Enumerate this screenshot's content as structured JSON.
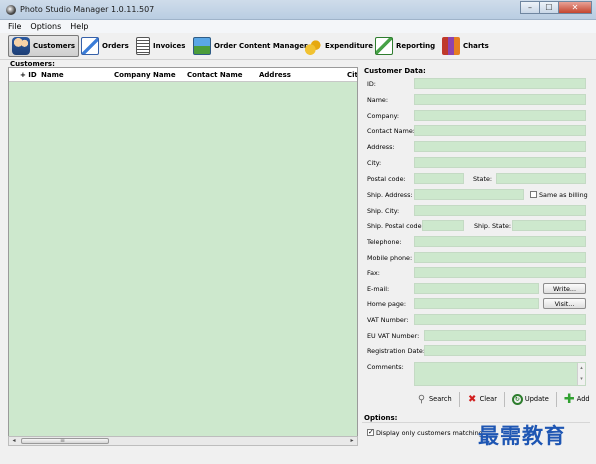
{
  "window": {
    "title": "Photo Studio Manager 1.0.11.507",
    "min": "–",
    "max": "☐",
    "close": "✕"
  },
  "menu": [
    "File",
    "Options",
    "Help"
  ],
  "toolbar": {
    "customers": "Customers",
    "orders": "Orders",
    "invoices": "Invoices",
    "order_content": "Order Content Manager",
    "expenditure": "Expenditure",
    "reporting": "Reporting",
    "charts": "Charts"
  },
  "customers_panel": {
    "label": "Customers:",
    "columns": {
      "id": "+ ID",
      "name": "Name",
      "company": "Company Name",
      "contact": "Contact Name",
      "address": "Address",
      "city": "City"
    }
  },
  "customer_data": {
    "label": "Customer Data:",
    "fields": {
      "id": "ID:",
      "name": "Name:",
      "company": "Company:",
      "contact": "Contact Name:",
      "address": "Address:",
      "city": "City:",
      "postal": "Postal code:",
      "state": "State:",
      "ship_address": "Ship. Address:",
      "same_as_billing": "Same as billing",
      "ship_city": "Ship. City:",
      "ship_postal": "Ship. Postal code:",
      "ship_state": "Ship. State:",
      "telephone": "Telephone:",
      "mobile": "Mobile phone:",
      "fax": "Fax:",
      "email": "E-mail:",
      "write": "Write...",
      "homepage": "Home page:",
      "visit": "Visit...",
      "vat": "VAT Number:",
      "eu_vat": "EU VAT Number:",
      "registration": "Registration Date:",
      "comments": "Comments:"
    },
    "actions": {
      "search": "Search",
      "clear": "Clear",
      "update": "Update",
      "add": "Add"
    }
  },
  "options": {
    "label": "Options:",
    "display_matching": "Display only customers matching",
    "checked": true
  },
  "scroll": {
    "left": "◂",
    "right": "▸",
    "grip": "≡",
    "up": "▴",
    "down": "▾"
  },
  "watermark": "最需教育"
}
